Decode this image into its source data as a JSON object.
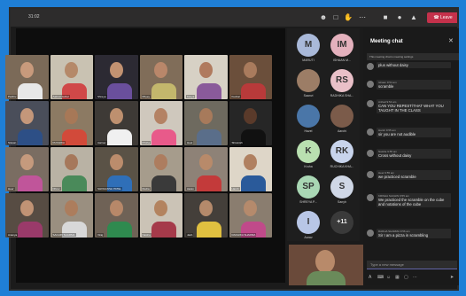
{
  "topbar": {
    "clock": "31:02",
    "leave_label": "Leave",
    "icons": [
      "people-icon",
      "chat-icon",
      "raise-hand-icon",
      "more-icon",
      "camera-icon",
      "mic-icon",
      "share-icon",
      "phone-icon"
    ]
  },
  "grid": {
    "tiles": [
      {
        "caption": "Parthiv",
        "bg": "#7b6a58",
        "face": "#c89a7c",
        "body": "#e8e8e8"
      },
      {
        "caption": "Aakruti Gohel",
        "bg": "#c9c2b2",
        "face": "#b58969",
        "body": "#d04848"
      },
      {
        "caption": "Shreya",
        "bg": "#2c2a33",
        "face": "#c29271",
        "body": "#6a4f9c"
      },
      {
        "caption": "Dhyey",
        "bg": "#806d59",
        "face": "#b9876a",
        "body": "#c3b76c"
      },
      {
        "caption": "Kavya",
        "bg": "#d7d1c5",
        "face": "#b07a5e",
        "body": "#8a5a9a"
      },
      {
        "caption": "Kushal",
        "bg": "#6b4f3b",
        "face": "#a97b5d",
        "body": "#b83a3a"
      },
      {
        "caption": "Stavan",
        "bg": "#4a4e5a",
        "face": "#c4977a",
        "body": "#2d4f86"
      },
      {
        "caption": "RUCHIKA",
        "bg": "#8c7a63",
        "face": "#a77857",
        "body": "#d24a3a"
      },
      {
        "caption": "Aarnav",
        "bg": "#3e3a36",
        "face": "#be906f",
        "body": "#f0f0f0"
      },
      {
        "caption": "Prisha",
        "bg": "#cfc8bd",
        "face": "#b48264",
        "body": "#e85a8a"
      },
      {
        "caption": "Heet",
        "bg": "#6e6a5f",
        "face": "#a77a5b",
        "body": "#5a6e8a"
      },
      {
        "caption": "Shivansh",
        "bg": "#262626",
        "face": "#5a3a2a",
        "body": "#111111"
      },
      {
        "caption": "Heer",
        "bg": "#7a6d62",
        "face": "#c59a7d",
        "body": "#c0559a"
      },
      {
        "caption": "Dhruv",
        "bg": "#b9b2a4",
        "face": "#a6785b",
        "body": "#4a8a5a"
      },
      {
        "caption": "SHIVAANSH PATEL",
        "bg": "#5a5246",
        "face": "#bb8c6c",
        "body": "#2f6fb8"
      },
      {
        "caption": "Rudra",
        "bg": "#a69c8c",
        "face": "#ad7d5f",
        "body": "#3a3a3a"
      },
      {
        "caption": "Aarav",
        "bg": "#8e8277",
        "face": "#b88a6a",
        "body": "#c33a3a"
      },
      {
        "caption": "Harsh",
        "bg": "#ded6c8",
        "face": "#b08060",
        "body": "#2a5a9a"
      },
      {
        "caption": "Ananya",
        "bg": "#574c43",
        "face": "#c19375",
        "body": "#9a3a6a"
      },
      {
        "caption": "SACHIN SHARMA",
        "bg": "#9a8f80",
        "face": "#ac7d5d",
        "body": "#d8d8d8"
      },
      {
        "caption": "Viraj",
        "bg": "#6f6256",
        "face": "#b78869",
        "body": "#2f8a4f"
      },
      {
        "caption": "Naisha",
        "bg": "#cbc3b6",
        "face": "#b3835f",
        "body": "#a53a4a"
      },
      {
        "caption": "Jash",
        "bg": "#443f3a",
        "face": "#b58a6b",
        "body": "#e0c040"
      },
      {
        "caption": "RADHIKA SHARMA",
        "bg": "#8a7d6f",
        "face": "#b58a6c",
        "body": "#c04a8a"
      }
    ]
  },
  "roster": {
    "people": [
      {
        "initials": "M",
        "name": "MARUTI",
        "color": "#a9b9d9"
      },
      {
        "initials": "IM",
        "name": "ISHAAN M...",
        "color": "#e4b1bd"
      },
      {
        "initials": "",
        "name": "Saanvi",
        "color": "#9c7d66"
      },
      {
        "initials": "RS",
        "name": "RADHIKA SHA...",
        "color": "#e9c0c8"
      },
      {
        "initials": "",
        "name": "Hazel",
        "color": "#4a76a8"
      },
      {
        "initials": "",
        "name": "Aarohi",
        "color": "#7b5b4a"
      },
      {
        "initials": "K",
        "name": "Kruha",
        "color": "#b9e0b0"
      },
      {
        "initials": "RK",
        "name": "RUCHIKA KHA...",
        "color": "#c8d4ec"
      },
      {
        "initials": "SP",
        "name": "SHREYA P...",
        "color": "#a9d7b4"
      },
      {
        "initials": "S",
        "name": "Sanyh",
        "color": "#cfd7e6"
      },
      {
        "initials": "I",
        "name": "Aarav",
        "color": "#b8c6e6"
      },
      {
        "initials": "+11",
        "name": "",
        "color": "#3a3a3a"
      }
    ]
  },
  "chat": {
    "title": "Meeting chat",
    "note": "This meeting chat is meeting settings",
    "messages": [
      {
        "author": "",
        "time": "",
        "text": "plus without daisy"
      },
      {
        "author": "Ishaan",
        "time": "9:54 am",
        "text": "scramble"
      },
      {
        "author": "Anhad",
        "time": "9:54 am",
        "text": "CAN YOU REPEST/THAT WHAT YOU TAUGHT IN THE CLASS"
      },
      {
        "author": "Harsh",
        "time": "9:55 am",
        "text": "sir you are not audible"
      },
      {
        "author": "Naisha",
        "time": "9:55 am",
        "text": "Cross without daisy"
      },
      {
        "author": "Heet",
        "time": "9:55 am",
        "text": "we practiced scramble"
      },
      {
        "author": "KRISHA SACHIN",
        "time": "9:55 am",
        "text": "We practiced the scramble on the cube and notations of the cube"
      },
      {
        "author": "RADHA SHARMA",
        "time": "9:56 am",
        "text": "Sir I am a pizza in scrambling"
      }
    ],
    "compose_placeholder": "Type a new message",
    "tools": [
      "format-icon",
      "attach-icon",
      "emoji-icon",
      "gif-icon",
      "sticker-icon",
      "more-icon",
      "send-icon"
    ]
  }
}
